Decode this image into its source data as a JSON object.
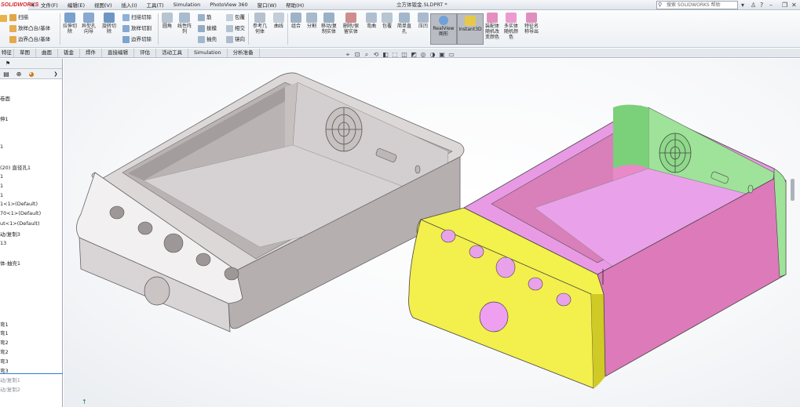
{
  "app": {
    "logo": "SOLIDWORKS",
    "doc_title": "立方体钣金.SLDPRT *",
    "search_placeholder": "搜索 SOLIDWORKS 帮助",
    "help_label": "?"
  },
  "menu": [
    "文件(F)",
    "编辑(E)",
    "视图(V)",
    "插入(I)",
    "工具(T)",
    "Simulation",
    "PhotoView 360",
    "窗口(W)",
    "帮助(H)"
  ],
  "ribbon": {
    "left_small": [
      "扫描",
      "放样凸台/基体",
      "边界凸台/基体"
    ],
    "big_1": [
      "拉伸切除",
      "异型孔向导",
      "旋转切除"
    ],
    "cut_small": [
      "扫描切除",
      "放样切割",
      "边界切除"
    ],
    "big_2": [
      "圆角",
      "线性阵列"
    ],
    "mid_small": [
      "筋",
      "拔模",
      "抽壳"
    ],
    "mid_small2": [
      "包覆",
      "相交",
      "镜向"
    ],
    "big_3": [
      "参考几何体",
      "曲线"
    ],
    "big_4": [
      "组合",
      "分割",
      "移动/复制实体",
      "删除/保留实体",
      "弯曲",
      "包覆",
      "简单直孔",
      "压凹"
    ],
    "toggles": [
      "RealView 图形",
      "Instant3D"
    ],
    "big_5": [
      "装配体随机改变颜色",
      "多实体随机颜色",
      "特征名称导出"
    ]
  },
  "command_tabs": [
    "特征",
    "草图",
    "曲面",
    "钣金",
    "焊件",
    "直接编辑",
    "评估",
    "活动工具",
    "Simulation",
    "分析准备"
  ],
  "tree": {
    "items": [
      "卷面",
      "伸1",
      "1",
      "(20) 直径孔1",
      "1",
      "1",
      "1",
      "1<1>(Default)",
      "70<1>(Default)",
      "ut<1>(Default)",
      "动/复制3",
      "13",
      "体-抽壳1",
      "弯1",
      "弯1",
      "弯2",
      "弯2",
      "弯3",
      "弯3",
      "动/复制1",
      "动/复制2"
    ]
  },
  "viewport": {
    "description_colors": {
      "body_gray": "#d8d3d3",
      "body_gray_dark": "#a9a3a4",
      "yellow": "#f2f04a",
      "pink": "#e07bc0",
      "green": "#a8e7a3",
      "magenta": "#e89be8"
    }
  }
}
